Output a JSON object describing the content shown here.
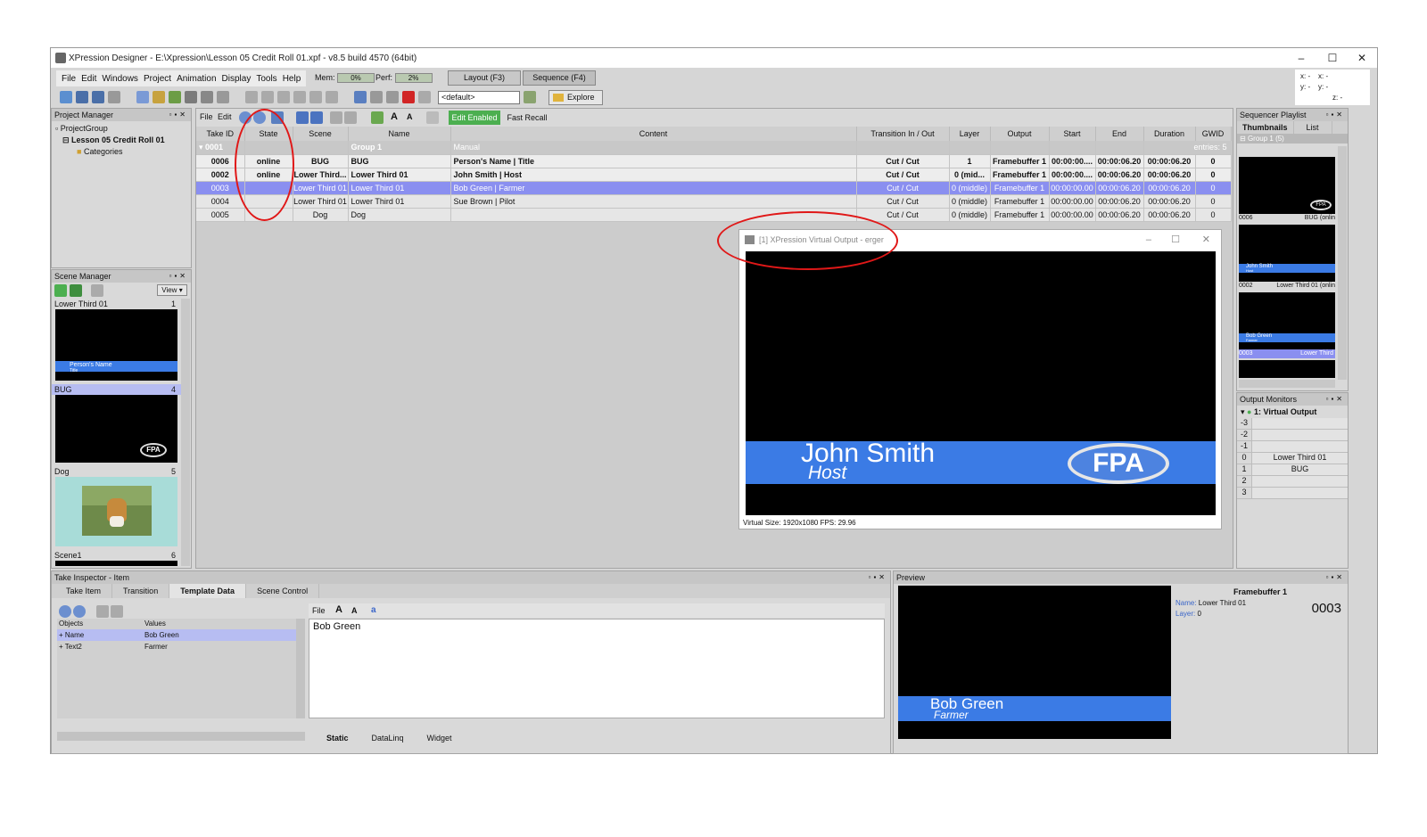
{
  "window": {
    "title": "XPression Designer - E:\\Xpression\\Lesson 05 Credit Roll 01.xpf - v8.5 build 4570 (64bit)",
    "controls": [
      "–",
      "☐",
      "✕"
    ]
  },
  "menu": [
    "File",
    "Edit",
    "Windows",
    "Project",
    "Animation",
    "Display",
    "Tools",
    "Help"
  ],
  "meters": {
    "mem_label": "Mem:",
    "mem_value": "0%",
    "perf_label": "Perf:",
    "perf_value": "2%"
  },
  "modes": {
    "layout": "Layout (F3)",
    "sequence": "Sequence (F4)"
  },
  "toolbar": {
    "preset": "<default>",
    "explore": "Explore"
  },
  "coords": {
    "x": "x: -",
    "x2": "x: -",
    "y": "y: -",
    "y2": "y: -",
    "z": "z: -"
  },
  "project_manager": {
    "title": "Project Manager",
    "items": [
      "ProjectGroup",
      "Lesson 05 Credit Roll 01",
      "Categories"
    ]
  },
  "scene_manager": {
    "title": "Scene Manager",
    "view": "View",
    "scenes": [
      {
        "name": "Lower Third 01",
        "num": "1",
        "overlay": "Person's Name",
        "sub": "Title"
      },
      {
        "name": "BUG",
        "num": "4",
        "logo": "FPA"
      },
      {
        "name": "Dog",
        "num": "5"
      },
      {
        "name": "Scene1",
        "num": "6"
      }
    ]
  },
  "takes_toolbar": {
    "file": "File",
    "edit": "Edit",
    "edit_enabled": "Edit Enabled",
    "fast_recall": "Fast Recall"
  },
  "takes": {
    "headers": [
      "Take ID",
      "State",
      "Scene",
      "Name",
      "Content",
      "Transition In / Out",
      "Layer",
      "Output",
      "Start",
      "End",
      "Duration",
      "GWID"
    ],
    "group": {
      "id": "0001",
      "name": "Group 1",
      "content": "Manual",
      "entries": "entries: 5"
    },
    "rows": [
      {
        "id": "0006",
        "state": "online",
        "scene": "BUG",
        "name": "BUG",
        "content": "Person's Name | Title",
        "trans": "Cut / Cut",
        "layer": "1",
        "output": "Framebuffer 1",
        "start": "00:00:00....",
        "end": "00:00:06.20",
        "dur": "00:00:06.20",
        "gwid": "0",
        "style": "online"
      },
      {
        "id": "0002",
        "state": "online",
        "scene": "Lower Third...",
        "name": "Lower Third 01",
        "content": "John Smith | Host",
        "trans": "Cut / Cut",
        "layer": "0 (mid...",
        "output": "Framebuffer 1",
        "start": "00:00:00....",
        "end": "00:00:06.20",
        "dur": "00:00:06.20",
        "gwid": "0",
        "style": "online"
      },
      {
        "id": "0003",
        "state": "",
        "scene": "Lower Third 01",
        "name": "Lower Third 01",
        "content": "Bob Green | Farmer",
        "trans": "Cut / Cut",
        "layer": "0 (middle)",
        "output": "Framebuffer 1",
        "start": "00:00:00.00",
        "end": "00:00:06.20",
        "dur": "00:00:06.20",
        "gwid": "0",
        "style": "sel"
      },
      {
        "id": "0004",
        "state": "",
        "scene": "Lower Third 01",
        "name": "Lower Third 01",
        "content": "Sue Brown | Pilot",
        "trans": "Cut / Cut",
        "layer": "0 (middle)",
        "output": "Framebuffer 1",
        "start": "00:00:00.00",
        "end": "00:00:06.20",
        "dur": "00:00:06.20",
        "gwid": "0",
        "style": "normal"
      },
      {
        "id": "0005",
        "state": "",
        "scene": "Dog",
        "name": "Dog",
        "content": "",
        "trans": "Cut / Cut",
        "layer": "0 (middle)",
        "output": "Framebuffer 1",
        "start": "00:00:00.00",
        "end": "00:00:06.20",
        "dur": "00:00:06.20",
        "gwid": "0",
        "style": "normal"
      }
    ]
  },
  "virtual_output": {
    "title": "[1] XPression Virtual Output - erger",
    "name": "John Smith",
    "role": "Host",
    "logo": "FPA",
    "status": "Virtual Size: 1920x1080  FPS: 29.96"
  },
  "sequencer": {
    "title": "Sequencer Playlist",
    "tabs": [
      "Thumbnails",
      "List"
    ],
    "group": "Group 1 (5)",
    "items": [
      {
        "id": "0006",
        "label": "BUG (onlin"
      },
      {
        "id": "0002",
        "label": "Lower Third 01 (onlin",
        "name": "John Smith",
        "sub": "Host"
      },
      {
        "id": "0003",
        "label": "Lower Third",
        "name": "Bob Green",
        "sub": "Farmer"
      }
    ]
  },
  "output_monitors": {
    "title": "Output Monitors",
    "output": "1: Virtual Output",
    "rows": [
      {
        "n": "-3",
        "v": ""
      },
      {
        "n": "-2",
        "v": ""
      },
      {
        "n": "-1",
        "v": ""
      },
      {
        "n": "0",
        "v": "Lower Third 01"
      },
      {
        "n": "1",
        "v": "BUG"
      },
      {
        "n": "2",
        "v": ""
      },
      {
        "n": "3",
        "v": ""
      }
    ]
  },
  "take_inspector": {
    "title": "Take Inspector - Item",
    "tabs": [
      "Take Item",
      "Transition",
      "Template Data",
      "Scene Control"
    ],
    "col_objects": "Objects",
    "col_values": "Values",
    "rows": [
      {
        "obj": "Name",
        "val": "Bob Green"
      },
      {
        "obj": "Text2",
        "val": "Farmer"
      }
    ],
    "editor_file": "File",
    "editor_text": "Bob Green",
    "bottom_tabs": [
      "Static",
      "DataLinq",
      "Widget"
    ]
  },
  "preview": {
    "title": "Preview",
    "fb": "Framebuffer 1",
    "name_label": "Name:",
    "name_value": "Lower Third 01",
    "layer_label": "Layer:",
    "layer_value": "0",
    "take_id": "0003",
    "overlay_name": "Bob Green",
    "overlay_sub": "Farmer"
  },
  "colors": {
    "accent_blue": "#3b7be5",
    "selection": "#8a8ff0",
    "annotation": "#e01818",
    "edit_enabled": "#4caf50"
  }
}
